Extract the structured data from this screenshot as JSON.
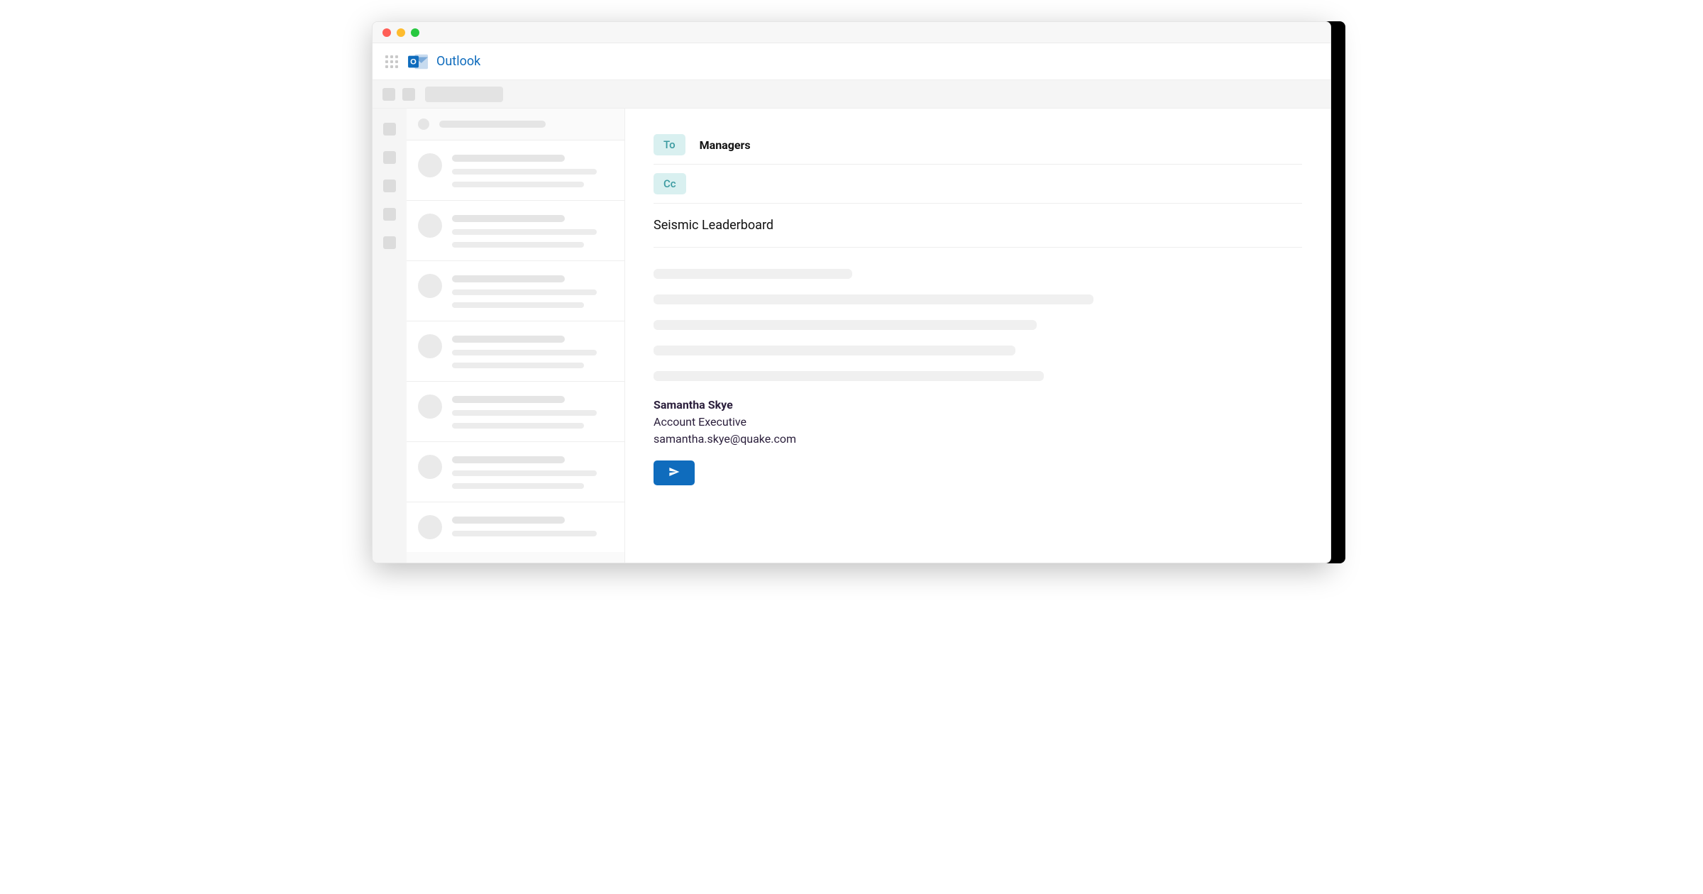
{
  "app": {
    "title": "Outlook"
  },
  "compose": {
    "to_label": "To",
    "cc_label": "Cc",
    "to_value": "Managers",
    "cc_value": "",
    "subject": "Seismic Leaderboard"
  },
  "signature": {
    "name": "Samantha Skye",
    "title": "Account Executive",
    "email": "samantha.skye@quake.com"
  },
  "colors": {
    "brand": "#0f6cbd",
    "chip_bg": "#d9f0f0",
    "chip_text": "#3a9aa0"
  },
  "icons": {
    "send": "send-icon",
    "app_launcher": "waffle-icon",
    "outlook_logo": "outlook-logo-icon"
  }
}
